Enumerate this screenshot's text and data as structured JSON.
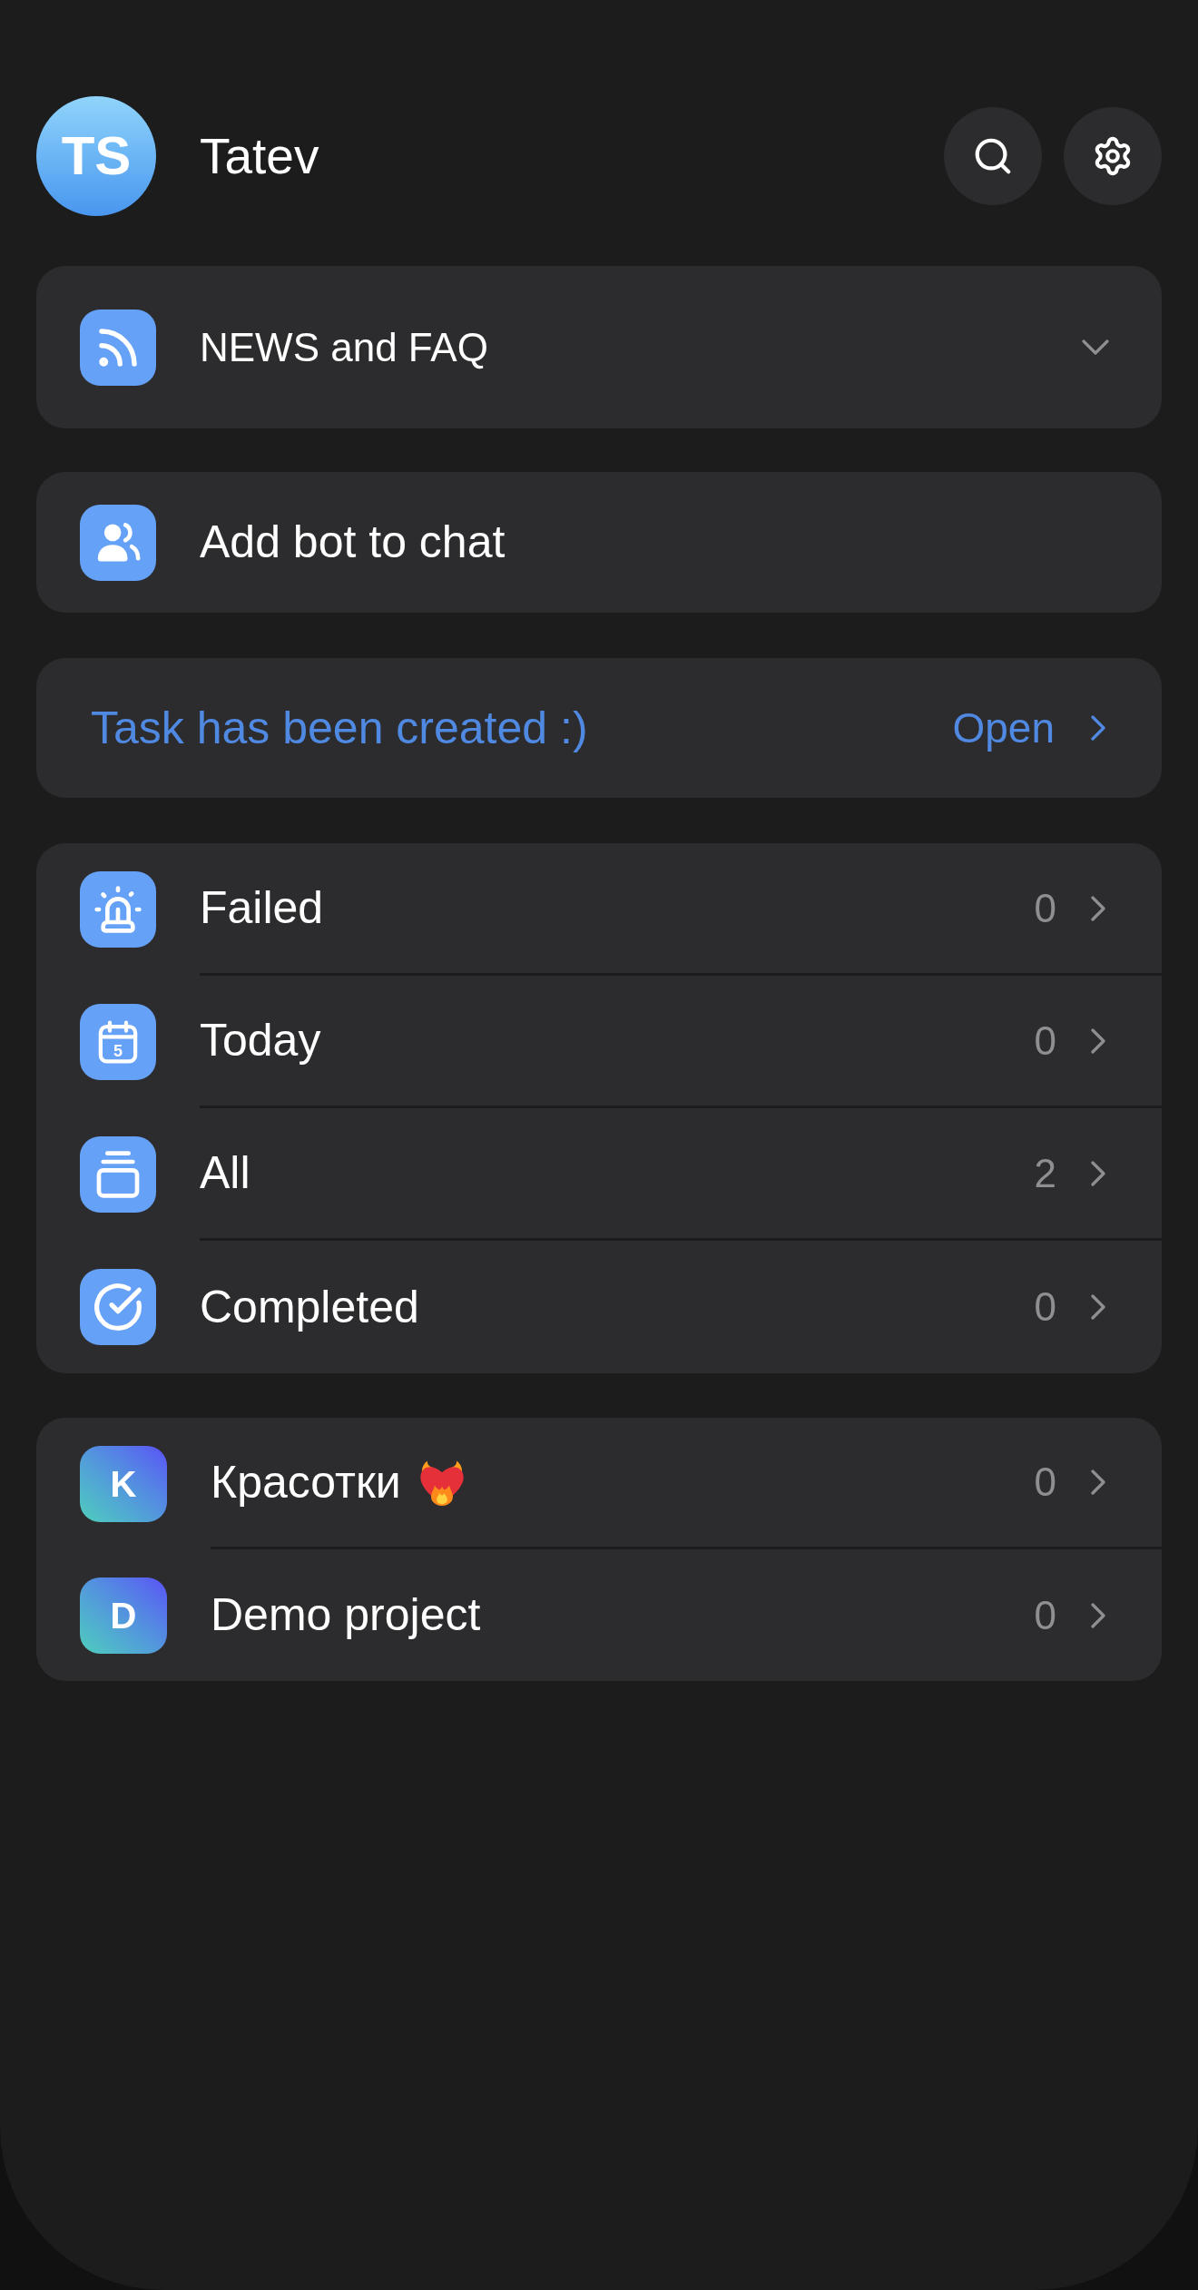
{
  "header": {
    "avatar_initials": "TS",
    "user_name": "Tatev"
  },
  "news": {
    "title": "NEWS and FAQ",
    "expanded": false
  },
  "add_bot": {
    "label": "Add bot to chat"
  },
  "task_banner": {
    "message": "Task has been created :)",
    "action": "Open"
  },
  "filters": [
    {
      "kind": "failed",
      "label": "Failed",
      "count": "0"
    },
    {
      "kind": "today",
      "label": "Today",
      "count": "0",
      "icon_label": "5"
    },
    {
      "kind": "all",
      "label": "All",
      "count": "2"
    },
    {
      "kind": "completed",
      "label": "Completed",
      "count": "0"
    }
  ],
  "projects": [
    {
      "initial": "K",
      "name": "Красотки",
      "emoji": true,
      "count": "0"
    },
    {
      "initial": "D",
      "name": "Demo project",
      "emoji": false,
      "count": "0"
    }
  ]
}
